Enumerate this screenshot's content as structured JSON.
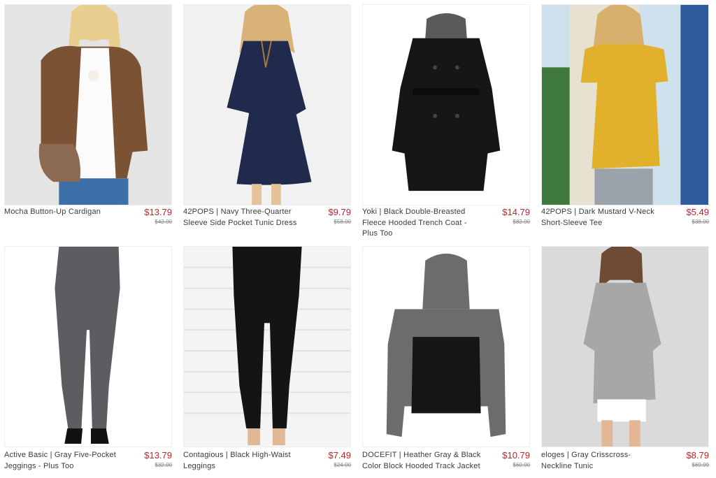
{
  "products": [
    {
      "title": "Mocha Button-Up Cardigan",
      "price": "$13.79",
      "original_price": "$42.00"
    },
    {
      "title": "42POPS | Navy Three-Quarter Sleeve Side Pocket Tunic Dress",
      "price": "$9.79",
      "original_price": "$58.00"
    },
    {
      "title": "Yoki | Black Double-Breasted Fleece Hooded Trench Coat - Plus Too",
      "price": "$14.79",
      "original_price": "$82.00"
    },
    {
      "title": "42POPS | Dark Mustard V-Neck Short-Sleeve Tee",
      "price": "$5.49",
      "original_price": "$38.00"
    },
    {
      "title": "Active Basic | Gray Five-Pocket Jeggings - Plus Too",
      "price": "$13.79",
      "original_price": "$32.00"
    },
    {
      "title": "Contagious | Black High-Waist Leggings",
      "price": "$7.49",
      "original_price": "$24.00"
    },
    {
      "title": "DOCEFIT | Heather Gray & Black Color Block Hooded Track Jacket",
      "price": "$10.79",
      "original_price": "$60.00"
    },
    {
      "title": "eloges | Gray Crisscross-Neckline Tunic",
      "price": "$8.79",
      "original_price": "$69.99"
    }
  ]
}
